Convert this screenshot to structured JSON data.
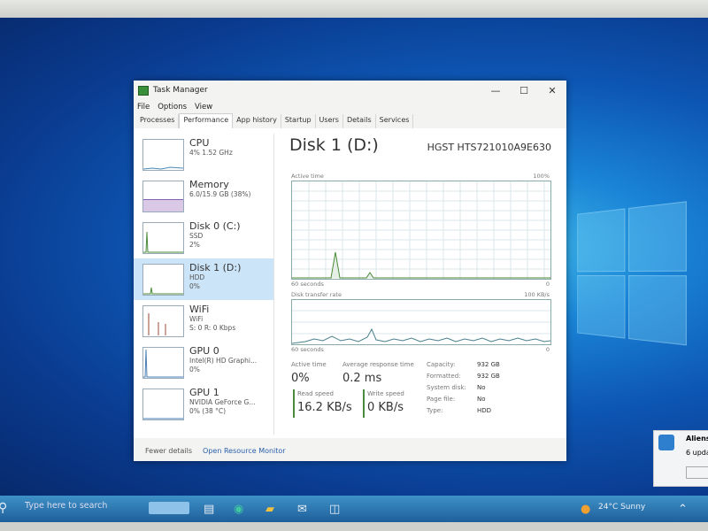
{
  "window": {
    "title": "Task Manager",
    "controls": [
      "—",
      "☐",
      "✕"
    ]
  },
  "menu": [
    "File",
    "Options",
    "View"
  ],
  "tabs": [
    "Processes",
    "Performance",
    "App history",
    "Startup",
    "Users",
    "Details",
    "Services"
  ],
  "active_tab": "Performance",
  "sidebar": [
    {
      "name": "CPU",
      "l1": "4% 1.52 GHz",
      "l2": "",
      "selected": false
    },
    {
      "name": "Memory",
      "l1": "6.0/15.9 GB (38%)",
      "l2": "",
      "selected": false
    },
    {
      "name": "Disk 0 (C:)",
      "l1": "SSD",
      "l2": "2%",
      "selected": false
    },
    {
      "name": "Disk 1 (D:)",
      "l1": "HDD",
      "l2": "0%",
      "selected": true
    },
    {
      "name": "WiFi",
      "l1": "WiFi",
      "l2": "S: 0 R: 0 Kbps",
      "selected": false
    },
    {
      "name": "GPU 0",
      "l1": "Intel(R) HD Graphi...",
      "l2": "0%",
      "selected": false
    },
    {
      "name": "GPU 1",
      "l1": "NVIDIA GeForce G...",
      "l2": "0% (38 °C)",
      "selected": false
    }
  ],
  "detail": {
    "title": "Disk 1 (D:)",
    "model": "HGST HTS721010A9E630",
    "graph1": {
      "label": "Active time",
      "max": "100%",
      "span": "60 seconds",
      "min": "0"
    },
    "graph2": {
      "label": "Disk transfer rate",
      "max": "100 KB/s",
      "span": "60 seconds",
      "min": "0"
    },
    "active_time": {
      "label": "Active time",
      "value": "0%"
    },
    "avg_response": {
      "label": "Average response time",
      "value": "0.2 ms"
    },
    "read_speed": {
      "label": "Read speed",
      "value": "16.2 KB/s"
    },
    "write_speed": {
      "label": "Write speed",
      "value": "0 KB/s"
    },
    "props": [
      {
        "k": "Capacity:",
        "v": "932 GB"
      },
      {
        "k": "Formatted:",
        "v": "932 GB"
      },
      {
        "k": "System disk:",
        "v": "No"
      },
      {
        "k": "Page file:",
        "v": "No"
      },
      {
        "k": "Type:",
        "v": "HDD"
      }
    ]
  },
  "footer": {
    "fewer": "Fewer details",
    "open": "Open Resource Monitor"
  },
  "toast": {
    "title": "Aliens",
    "text": "6 upda"
  },
  "taskbar": {
    "search": "Type here to search",
    "weather": "24°C  Sunny"
  },
  "colors": {
    "selected_bg": "#cce4f7",
    "graph_line": "#4a7f8c",
    "accent": "#2a5fa8"
  }
}
